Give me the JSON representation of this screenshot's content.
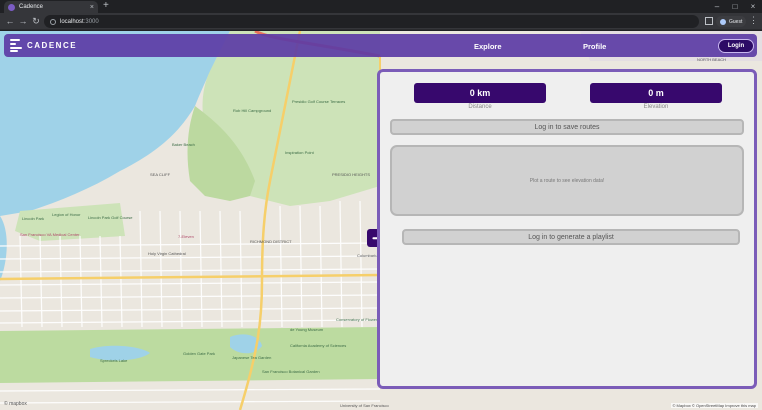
{
  "browser": {
    "tab_title": "Cadence",
    "tab_close": "×",
    "new_tab": "+",
    "window_controls": [
      "–",
      "□",
      "×"
    ],
    "nav": {
      "back": "←",
      "forward": "→",
      "reload": "↻"
    },
    "url_host": "localhost",
    "url_port": ":3000",
    "profile_label": "Guest",
    "menu": "⋮"
  },
  "app": {
    "logo_text": "CADENCE",
    "nav": {
      "explore": "Explore",
      "profile": "Profile"
    },
    "login_button": "Login",
    "toggle_icon": "➜"
  },
  "panel": {
    "distance_value": "0 km",
    "distance_label": "Distance",
    "elevation_value": "0 m",
    "elevation_label": "Elevation",
    "save_routes": "Log in to save routes",
    "elevation_placeholder": "Plot a route to see elevation data!",
    "playlist_button": "Log in to generate a playlist"
  },
  "map": {
    "labels": {
      "campground": "Rob Hill Campground",
      "presidio_terraces": "Presidio Golf Course Terraces",
      "baker": "Baker Beach",
      "inspiration": "Inspiration Point",
      "presidio_heights": "PRESIDIO HEIGHTS",
      "lincoln_park": "Lincoln Park",
      "legion": "Legion of Honor",
      "lincoln_golf": "Lincoln Park Golf Course",
      "sea_cliff": "SEA CLIFF",
      "richmond": "RICHMOND DISTRICT",
      "seven_eleven": "7-Eleven",
      "holy_virgin": "Holy Virgin Cathedral",
      "sf_va": "San Francisco VA Medical Center",
      "de_young": "de Young Museum",
      "conservatory": "Conservatory of Flowers",
      "golden_gate_park": "Golden Gate Park",
      "spreckels": "Spreckels Lake",
      "cal_academy": "California Academy of Sciences",
      "botanical": "San Francisco Botanical Garden",
      "japanese_garden": "Japanese Tea Garden",
      "north_beach": "NORTH BEACH",
      "columbarium": "Columbarium",
      "university": "University of San Francisco"
    },
    "attribution": "© mapbox",
    "copyright": "© Mapbox © OpenStreetMap Improve this map"
  }
}
